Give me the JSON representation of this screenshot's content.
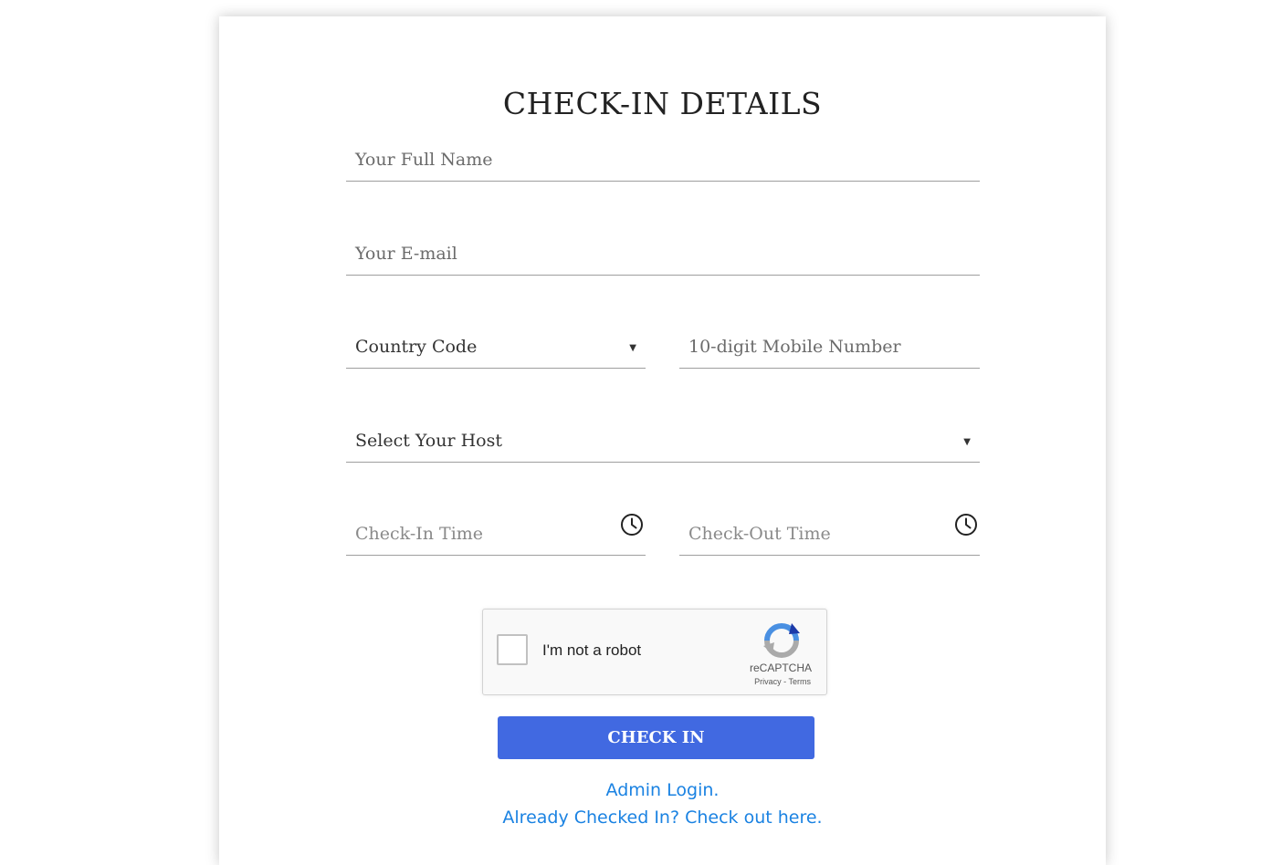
{
  "form": {
    "title": "CHECK-IN DETAILS",
    "full_name_placeholder": "Your Full Name",
    "email_placeholder": "Your E-mail",
    "country_code_label": "Country Code",
    "mobile_placeholder": "10-digit Mobile Number",
    "host_label": "Select Your Host",
    "checkin_time_placeholder": "Check-In Time",
    "checkout_time_placeholder": "Check-Out Time",
    "submit_label": "CHECK IN"
  },
  "captcha": {
    "label": "I'm not a robot",
    "brand": "reCAPTCHA",
    "privacy": "Privacy",
    "separator": " - ",
    "terms": "Terms",
    "checked": false
  },
  "links": {
    "admin_login": "Admin Login.",
    "check_out": "Already Checked In? Check out here."
  },
  "icons": {
    "dropdown": "caret-down-icon",
    "time": "clock-icon",
    "captcha": "recaptcha-logo-icon"
  },
  "colors": {
    "primary_button": "#4169e1",
    "link": "#1a82e2"
  }
}
